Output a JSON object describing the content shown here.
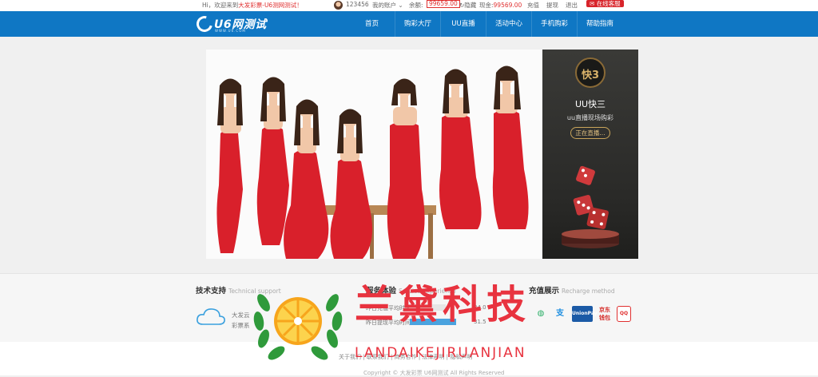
{
  "topbar": {
    "greeting": "Hi，欢迎来到",
    "brand_link": "大发彩票-U6测网测试！",
    "username": "123456",
    "my_account": "我的账户",
    "balance_label": "余额:",
    "balance_value": "99659.00",
    "hide_label": "隐藏",
    "points_label": "现金:",
    "points_value": "99569.00",
    "recharge": "充值",
    "withdraw": "提现",
    "logout": "退出",
    "customer_service": "在线客服"
  },
  "logo": {
    "text": "U6网测试",
    "subtitle": "WWW.U6.COM"
  },
  "nav": {
    "items": [
      "首页",
      "购彩大厅",
      "UU直播",
      "活动中心",
      "手机购彩",
      "帮助指南"
    ]
  },
  "side_panel": {
    "emblem_text": "快3",
    "title": "UU快三",
    "subtitle": "uu直播现场购彩",
    "live_button": "正在直播..."
  },
  "footer": {
    "tech_support": {
      "title": "技术支持",
      "title_en": "Technical support",
      "line1": "大发云",
      "line2": "彩票系"
    },
    "service": {
      "title": "服务体验",
      "title_en": "Service experience",
      "rows": [
        {
          "label": "昨日充值平均时间",
          "value": "34.0",
          "percent": 45
        },
        {
          "label": "昨日提现平均时间",
          "value": "31.5",
          "percent": 40
        }
      ]
    },
    "recharge": {
      "title": "充值展示",
      "title_en": "Recharge method",
      "methods": [
        "微信",
        "支付宝",
        "银联",
        "京东钱包",
        "QQ钱包"
      ]
    },
    "links_line": "关于我们 | 联系我们 | 商务合作 | 法律声明 | 隐私声明",
    "copyright_line": "Copyright © 大发彩票 U6网测试 All Rights Reserved"
  },
  "watermark": {
    "cn": "兰黛科技",
    "en": "LANDAIKEJIRUANJIAN"
  },
  "colors": {
    "nav_blue": "#0f77c4",
    "accent_red": "#e03030",
    "watermark_red": "#e8333f",
    "dress_red": "#d9202b"
  }
}
